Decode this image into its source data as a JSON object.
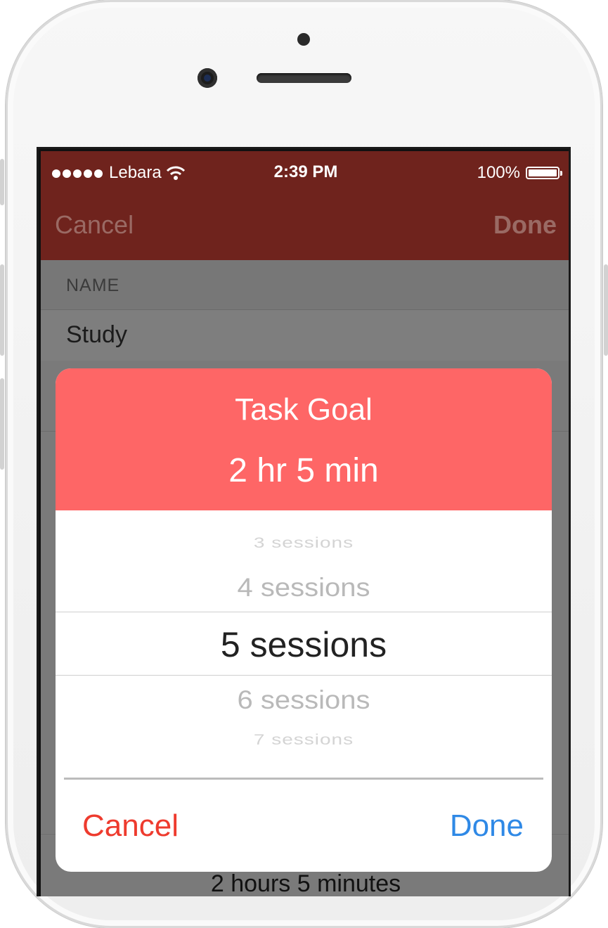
{
  "status_bar": {
    "carrier": "Lebara",
    "time": "2:39 PM",
    "battery": "100%"
  },
  "nav": {
    "cancel": "Cancel",
    "done": "Done"
  },
  "form": {
    "section_name": "NAME",
    "name_value": "Study",
    "goal_summary": "2 hours 5 minutes"
  },
  "dialog": {
    "title": "Task Goal",
    "value": "2 hr 5 min",
    "picker": {
      "options": [
        "3 sessions",
        "4 sessions",
        "5 sessions",
        "6 sessions",
        "7 sessions"
      ],
      "selected": "5 sessions"
    },
    "cancel": "Cancel",
    "done": "Done"
  },
  "colors": {
    "navbar": "#6f231d",
    "dialog_header": "#fe6666",
    "cancel": "#ee3b2e",
    "done": "#2f89e6"
  }
}
